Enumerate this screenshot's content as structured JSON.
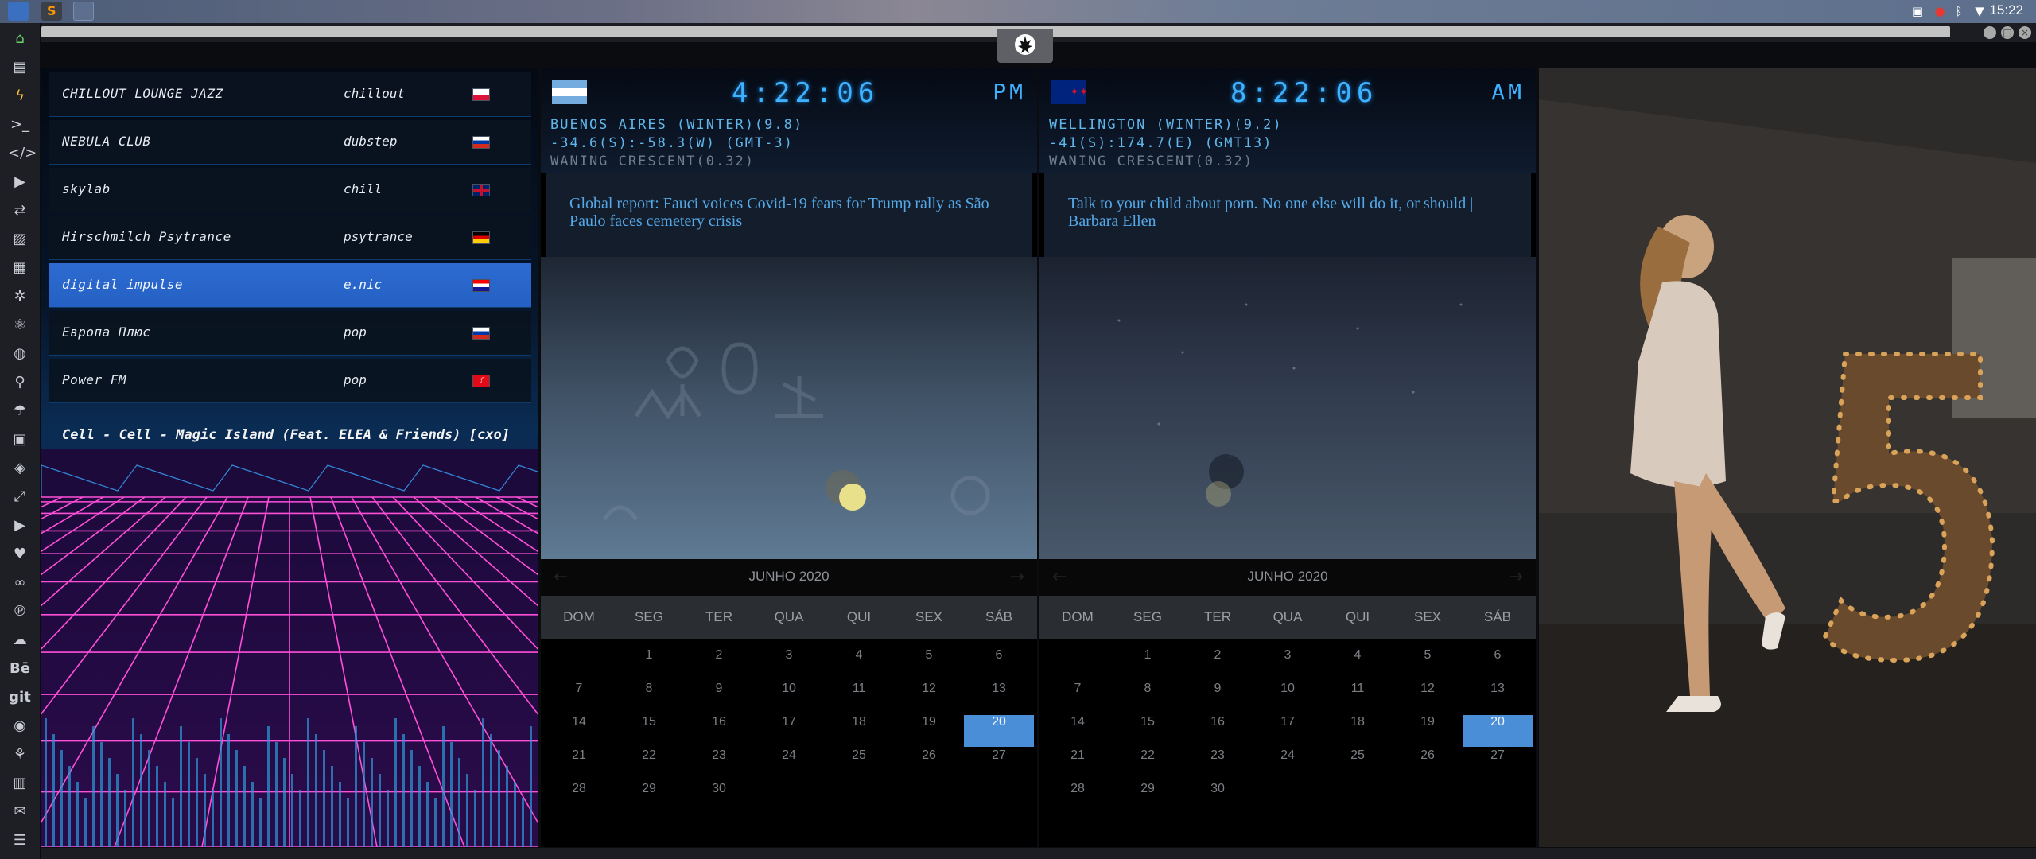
{
  "system": {
    "clock": "15:22"
  },
  "radio": {
    "stations": [
      {
        "name": "CHILLOUT LOUNGE JAZZ",
        "genre": "chillout",
        "flag": "pl"
      },
      {
        "name": "NEBULA CLUB",
        "genre": "dubstep",
        "flag": "ru"
      },
      {
        "name": "skylab",
        "genre": "chill",
        "flag": "gb"
      },
      {
        "name": "Hirschmilch Psytrance",
        "genre": "psytrance",
        "flag": "de"
      },
      {
        "name": "digital impulse",
        "genre": "e.nic",
        "flag": "hr",
        "active": true
      },
      {
        "name": "Европа Плюс",
        "genre": "pop",
        "flag": "ru"
      },
      {
        "name": "Power FM",
        "genre": "pop",
        "flag": "tr"
      }
    ],
    "now_playing": "Cell - Cell - Magic Island (Feat. ELEA & Friends) [cxo]"
  },
  "cities": [
    {
      "flag": "ar",
      "time": "4:22:06",
      "ampm": "PM",
      "line1": "BUENOS AIRES (WINTER)(9.8)",
      "line2": "-34.6(S):-58.3(W) (GMT-3)",
      "line3": "WANING CRESCENT(0.32)",
      "headline": "Global report: Fauci voices Covid-19 fears for Trump rally as São Paulo faces cemetery crisis",
      "calendar_month": "JUNHO 2020"
    },
    {
      "flag": "nz",
      "time": "8:22:06",
      "ampm": "AM",
      "line1": "WELLINGTON (WINTER)(9.2)",
      "line2": "-41(S):174.7(E) (GMT13)",
      "line3": "WANING CRESCENT(0.32)",
      "headline": "Talk to your child about porn. No one else will do it, or should | Barbara Ellen",
      "calendar_month": "JUNHO 2020"
    }
  ],
  "calendar": {
    "weekdays": [
      "DOM",
      "SEG",
      "TER",
      "QUA",
      "QUI",
      "SEX",
      "SÁB"
    ],
    "first_weekday_index": 1,
    "days_in_month": 30,
    "today": 20
  },
  "colors": {
    "accent": "#3fb2ff",
    "today": "#4a8ed8",
    "active_station": "#2d6bd1"
  }
}
